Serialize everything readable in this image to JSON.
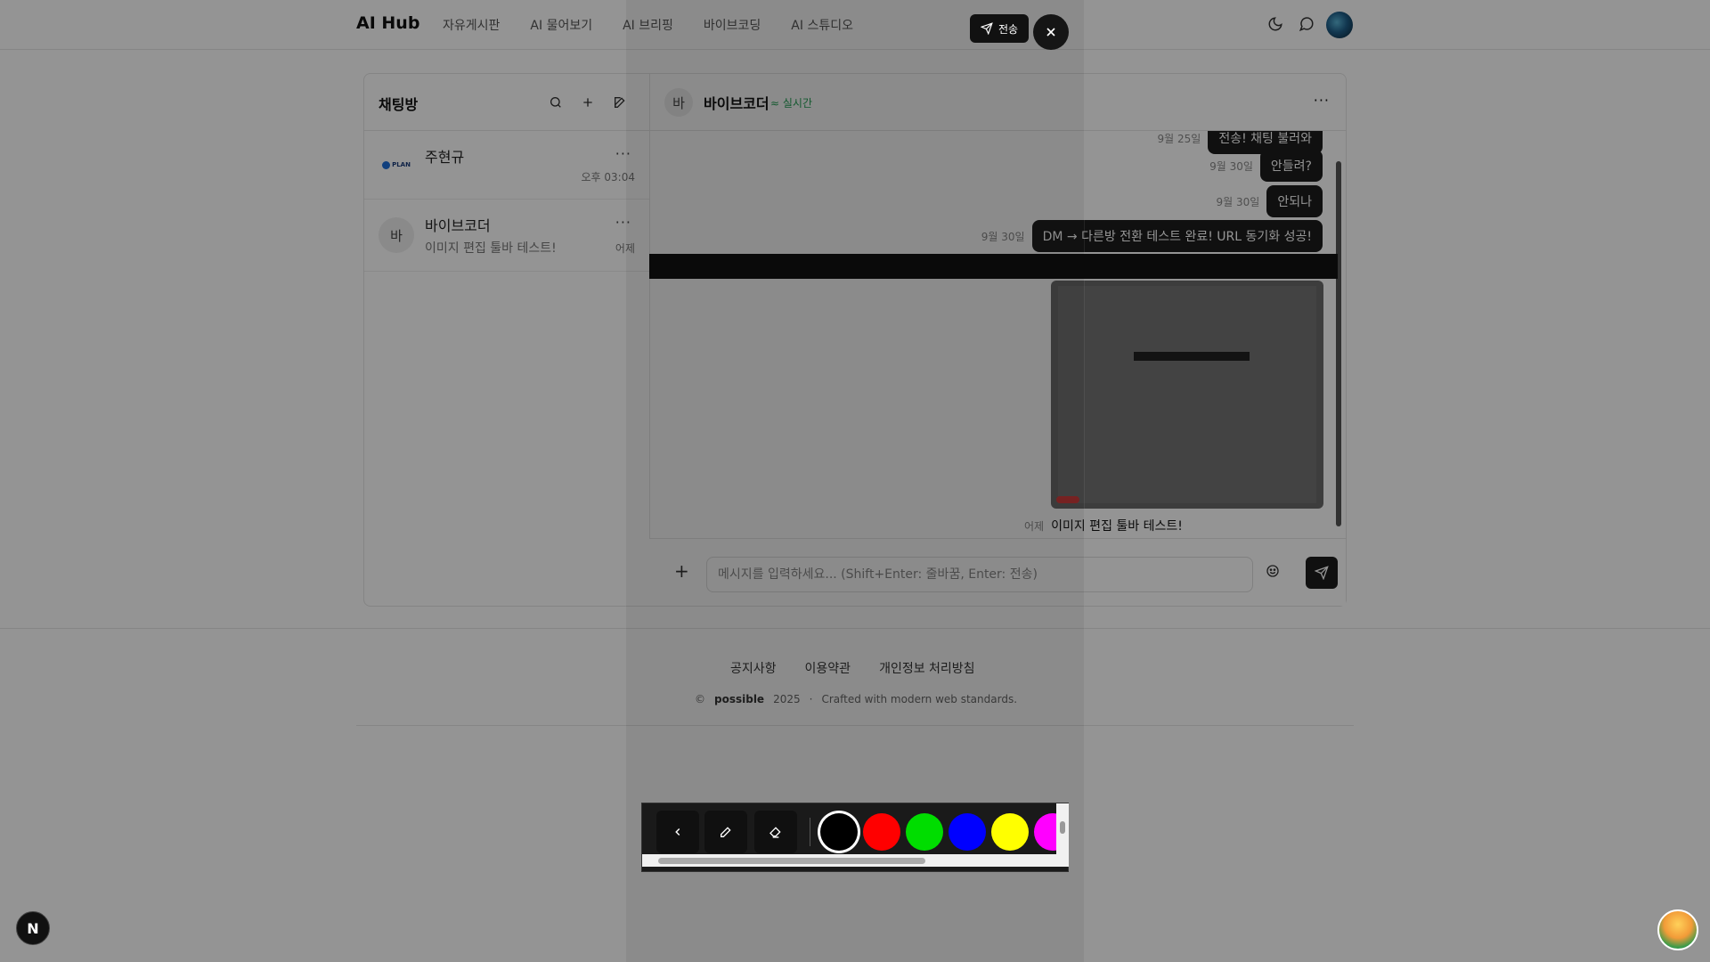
{
  "header": {
    "logo": "AI Hub",
    "nav": [
      "자유게시판",
      "AI 물어보기",
      "AI 브리핑",
      "바이브코딩",
      "AI 스튜디오"
    ]
  },
  "sidebar": {
    "title": "채팅방",
    "rooms": [
      {
        "name": "주현규",
        "preview": "",
        "time": "오후 03:04",
        "avatar_logo": "PLAN"
      },
      {
        "name": "바이브코더",
        "preview": "이미지 편집 툴바 테스트!",
        "time": "어제",
        "avatar_initial": "바"
      }
    ]
  },
  "chat": {
    "peer_initial": "바",
    "peer_name": "바이브코더",
    "status": "실시간",
    "messages": [
      {
        "time": "9월 25일",
        "text": "전송! 채팅 불러와"
      },
      {
        "time": "9월 30일",
        "text": "안들려?"
      },
      {
        "time": "9월 30일",
        "text": "안되나"
      },
      {
        "time": "9월 30일",
        "text": "DM → 다른방 전환 테스트 완료! URL 동기화 성공!"
      }
    ],
    "image_caption_time": "어제",
    "image_caption": "이미지 편집 툴바 테스트!",
    "input_placeholder": "메시지를 입력하세요... (Shift+Enter: 줄바꿈, Enter: 전송)"
  },
  "footer": {
    "links": [
      "공지사항",
      "이용약관",
      "개인정보 처리방침"
    ],
    "copyright_symbol": "©",
    "brand": "possible",
    "year": "2025",
    "separator": "·",
    "tagline": "Crafted with modern web standards."
  },
  "overlay": {
    "send_label": "전송",
    "palette": [
      "#000000",
      "#ff0000",
      "#00dd00",
      "#0000ff",
      "#ffff00",
      "#ff00ff"
    ],
    "selected_color": "#000000"
  },
  "badges": {
    "n_badge": "N"
  }
}
